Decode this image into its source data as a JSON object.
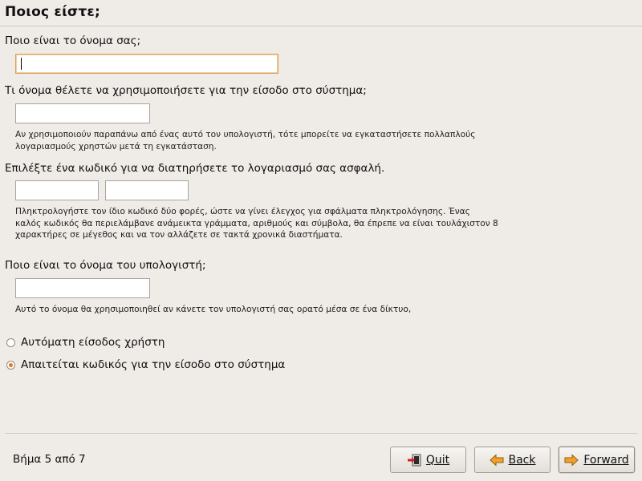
{
  "page": {
    "title": "Ποιος είστε;",
    "name_label": "Ποιο είναι το όνομα σας;",
    "name_value": "",
    "login_label": "Τι όνομα θέλετε να χρησιμοποιήσετε για την είσοδο στο σύστημα;",
    "login_value": "",
    "login_help_1": "Αν χρησιμοποιούν παραπάνω από ένας αυτό τον υπολογιστή, τότε μπορείτε να εγκαταστήσετε πολλαπλούς",
    "login_help_2": "λογαριασμούς χρηστών μετά τη εγκατάσταση.",
    "password_label": "Επιλέξτε ένα κωδικό για να διατηρήσετε το λογαριασμό σας ασφαλή.",
    "password_value": "",
    "password_confirm_value": "",
    "password_help_1": "Πληκτρολογήστε τον ίδιο κωδικό δύο φορές, ώστε να γίνει έλεγχος για σφάλματα πληκτρολόγησης. Ένας",
    "password_help_2": "καλός κωδικός θα περιελάμβανε ανάμεικτα γράμματα, αριθμούς και σύμβολα, θα έπρεπε να είναι τουλάχιστον 8",
    "password_help_3": "χαρακτήρες σε μέγεθος και να τον αλλάζετε σε τακτά χρονικά διαστήματα.",
    "hostname_label": "Ποιο είναι το όνομα του υπολογιστή;",
    "hostname_value": "",
    "hostname_help": "Αυτό το όνομα θα χρησιμοποιηθεί αν κάνετε τον υπολογιστή σας ορατό μέσα σε ένα δίκτυο,",
    "radio_autologin": "Αυτόματη είσοδος χρήστη",
    "radio_password": "Απαιτείται κωδικός για την είσοδο στο σύστημα",
    "selected_option": "radio_password"
  },
  "footer": {
    "step_text": "Βήμα 5 από 7",
    "quit_label": "Quit",
    "back_label": "Back",
    "forward_label": "Forward"
  },
  "icons": {
    "quit": "exit-icon",
    "back": "arrow-left-icon",
    "forward": "arrow-right-icon"
  },
  "colors": {
    "accent": "#e07a1a",
    "focus_border": "#d9a15b",
    "window_bg": "#efebe7"
  }
}
